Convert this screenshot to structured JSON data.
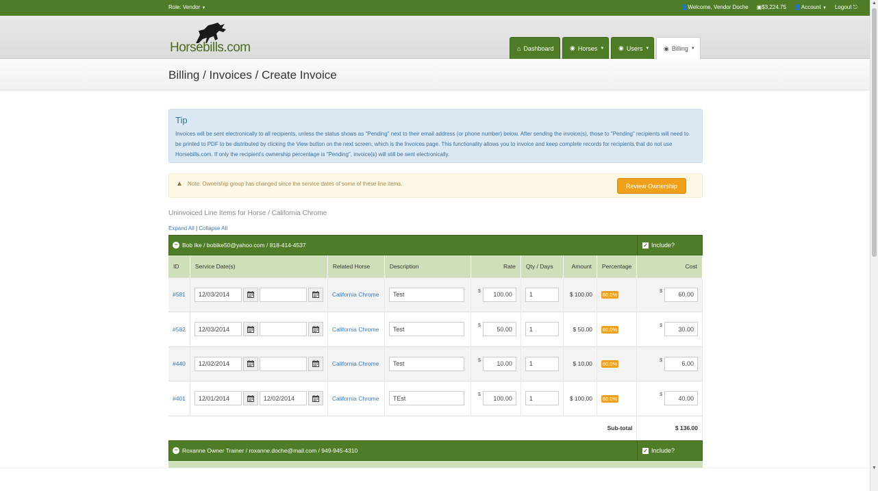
{
  "topbar": {
    "role": "Role: Vendor",
    "welcome": "Welcome, Vendor Doche",
    "balance": "$3,224.75",
    "account": "Account",
    "logout": "Logout"
  },
  "logo": {
    "text": "Horsebills.com"
  },
  "nav": [
    {
      "label": "Dashboard",
      "icon": "dashboard-icon"
    },
    {
      "label": "Horses",
      "icon": "eye-icon"
    },
    {
      "label": "Users",
      "icon": "eye-icon"
    },
    {
      "label": "Billing",
      "icon": "eye-icon",
      "active": true
    }
  ],
  "page": {
    "title": "Billing / Invoices / Create Invoice"
  },
  "tip": {
    "title": "Tip",
    "body": "Invoices will be sent electronically to all recipients, unless the status shows as \"Pending\" next to their email address (or phone number) below. After sending the invoice(s), those to \"Pending\" recipients will need to be printed to PDF to be distributed by clicking the View button on the next screen, which is the Invoices page. This functionality allows you to invoice and keep complete records for recipients that do not use Horsebills.com. If only the recipient's ownership percentage is \"Pending\", invoice(s) will still be sent electronically."
  },
  "warning": {
    "text": "Note: Ownership group has changed since the service dates of some of these line items.",
    "button": "Review Ownership"
  },
  "section": {
    "title": "Uninvoiced Line Items for Horse / California Chrome",
    "expand_all": "Expand All",
    "separator": "|",
    "collapse_all": "Collapse All"
  },
  "groups": [
    {
      "name": "Bob Ike / bobike50@yahoo.com / 818-414-4537",
      "include": "Include?"
    },
    {
      "name": "Roxanne Owner Trainer / roxanne.doche@mail.com / 949-945-4310",
      "include": "Include?"
    }
  ],
  "table": {
    "headers": [
      "ID",
      "Service Date(s)",
      "Related Horse",
      "Description",
      "Rate",
      "Qty / Days",
      "Amount",
      "Percentage",
      "Cost"
    ],
    "currency": "$",
    "rows": [
      {
        "id": "#581",
        "start": "12/03/2014",
        "end": "",
        "horse": "California Chrome",
        "desc": "Test",
        "rate": "100.00",
        "qty": "1",
        "amount": "$ 100.00",
        "pct": "60.0%",
        "cost": "60.00"
      },
      {
        "id": "#582",
        "start": "12/03/2014",
        "end": "",
        "horse": "California Chrome",
        "desc": "Test",
        "rate": "50.00",
        "qty": "1",
        "amount": "$ 50.00",
        "pct": "60.0%",
        "cost": "30.00"
      },
      {
        "id": "#440",
        "start": "12/02/2014",
        "end": "",
        "horse": "California Chrome",
        "desc": "Test",
        "rate": "10.00",
        "qty": "1",
        "amount": "$ 10.00",
        "pct": "60.0%",
        "cost": "6.00"
      },
      {
        "id": "#401",
        "start": "12/01/2014",
        "end": "12/02/2014",
        "horse": "California Chrome",
        "desc": "TEst",
        "rate": "100.00",
        "qty": "1",
        "amount": "$ 100.00",
        "pct": "60.0%",
        "cost": "40.00"
      }
    ],
    "subtotal_label": "Sub-total",
    "subtotal_value": "$ 136.00"
  }
}
